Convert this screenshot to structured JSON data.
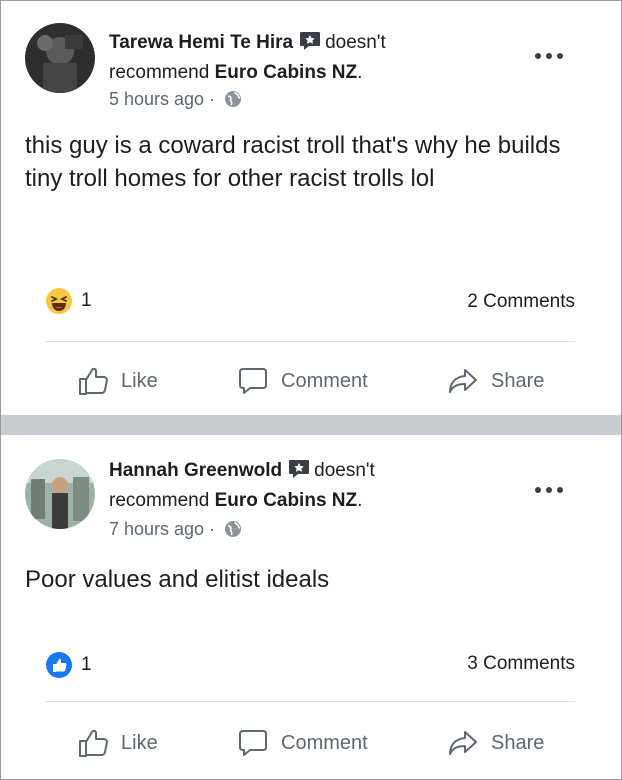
{
  "posts": [
    {
      "author": "Tarewa Hemi Te Hira",
      "verb": "doesn't",
      "rec_prefix": "recommend",
      "page": "Euro Cabins NZ",
      "period": ".",
      "time": "5 hours ago",
      "dot": "·",
      "text": "this guy is a coward racist troll that's why he builds tiny troll homes for other racist trolls lol",
      "reaction_icon": "laugh-haha-icon",
      "reaction_count": "1",
      "comments": "2 Comments",
      "actions": {
        "like": "Like",
        "comment": "Comment",
        "share": "Share"
      }
    },
    {
      "author": "Hannah Greenwold",
      "verb": "doesn't",
      "rec_prefix": "recommend",
      "page": "Euro Cabins NZ",
      "period": ".",
      "time": "7 hours ago",
      "dot": "·",
      "text": "Poor values and elitist ideals",
      "reaction_icon": "like-thumb-icon",
      "reaction_count": "1",
      "comments": "3 Comments",
      "actions": {
        "like": "Like",
        "comment": "Comment",
        "share": "Share"
      }
    }
  ],
  "colors": {
    "divider": "#c9ccd1",
    "secondary_text": "#606770",
    "like_blue": "#1877f2",
    "haha_yellow": "#f7c744"
  }
}
